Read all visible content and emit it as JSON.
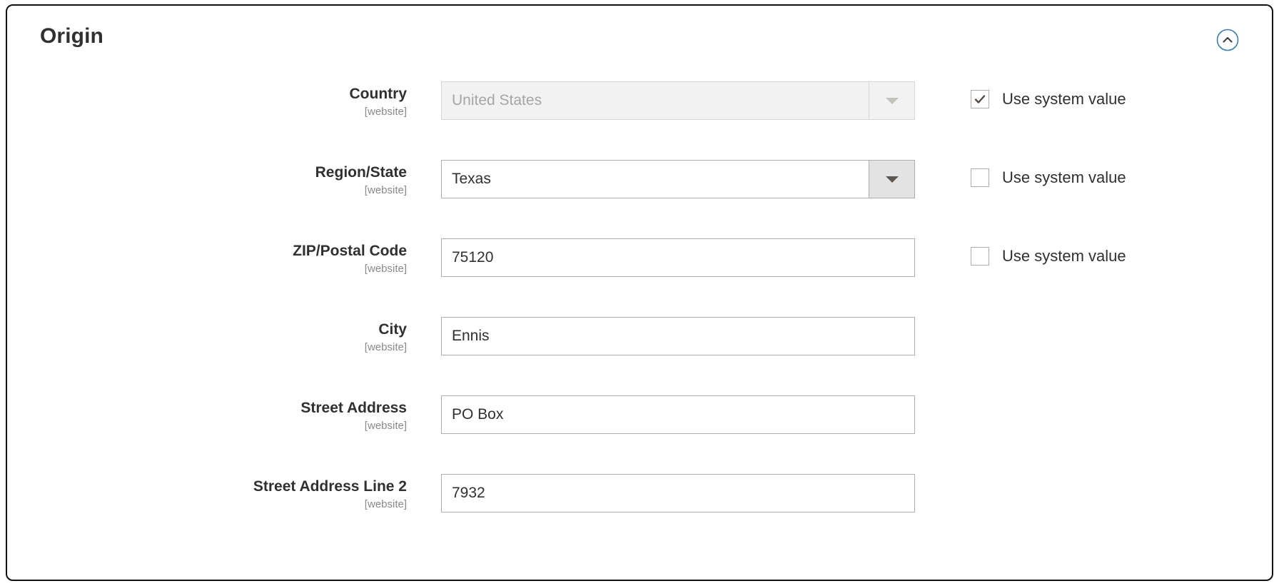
{
  "panel": {
    "title": "Origin",
    "collapse_icon": "chevron-up-circle-icon",
    "collapse_accent_color": "#3d7ab8"
  },
  "scope_label": "[website]",
  "system_value_label": "Use system value",
  "fields": [
    {
      "label": "Country",
      "scope": "[website]",
      "type": "select",
      "value": "United States",
      "disabled": true,
      "has_system_value": true,
      "system_value_checked": true
    },
    {
      "label": "Region/State",
      "scope": "[website]",
      "type": "select",
      "value": "Texas",
      "disabled": false,
      "has_system_value": true,
      "system_value_checked": false
    },
    {
      "label": "ZIP/Postal Code",
      "scope": "[website]",
      "type": "text",
      "value": "75120",
      "disabled": false,
      "has_system_value": true,
      "system_value_checked": false
    },
    {
      "label": "City",
      "scope": "[website]",
      "type": "text",
      "value": "Ennis",
      "disabled": false,
      "has_system_value": false,
      "system_value_checked": false
    },
    {
      "label": "Street Address",
      "scope": "[website]",
      "type": "text",
      "value": "PO Box",
      "disabled": false,
      "has_system_value": false,
      "system_value_checked": false
    },
    {
      "label": "Street Address Line 2",
      "scope": "[website]",
      "type": "text",
      "value": "7932",
      "disabled": false,
      "has_system_value": false,
      "system_value_checked": false
    }
  ]
}
